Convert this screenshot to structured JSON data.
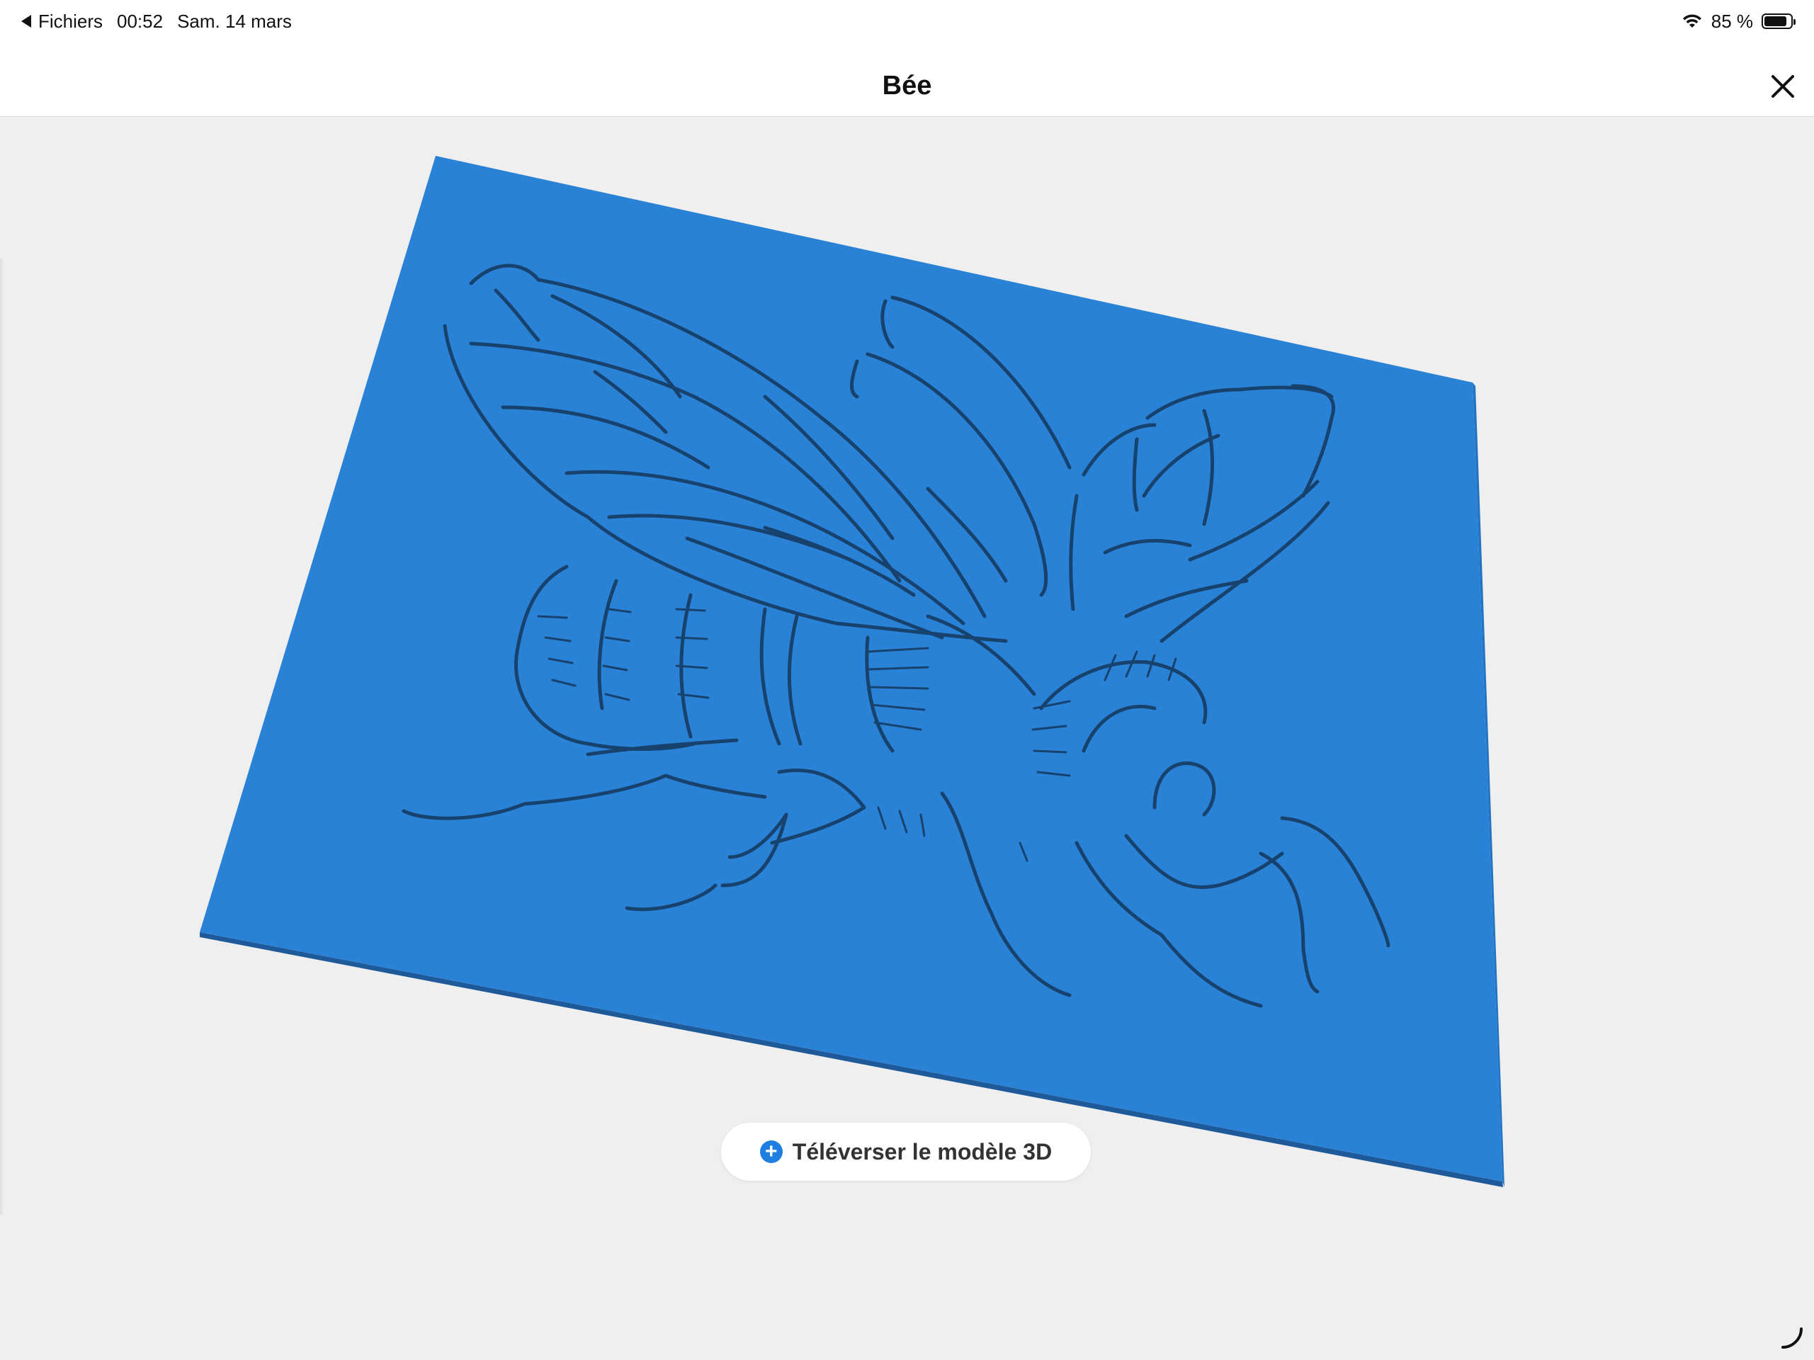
{
  "status_bar": {
    "back_app": "Fichiers",
    "time": "00:52",
    "date": "Sam. 14 mars",
    "battery": "85 %",
    "battery_level": 0.85
  },
  "nav": {
    "title": "Bée",
    "close_icon": "close-icon"
  },
  "viewer": {
    "model_name": "Bée",
    "plate_color": "#2a82d7",
    "edge_color": "#1e5a9a",
    "groove_color": "#17426d",
    "background": "#efefef"
  },
  "actions": {
    "upload_label": "Téléverser le modèle 3D",
    "upload_icon": "plus-circle-icon",
    "accent": "#1f7fe0"
  }
}
